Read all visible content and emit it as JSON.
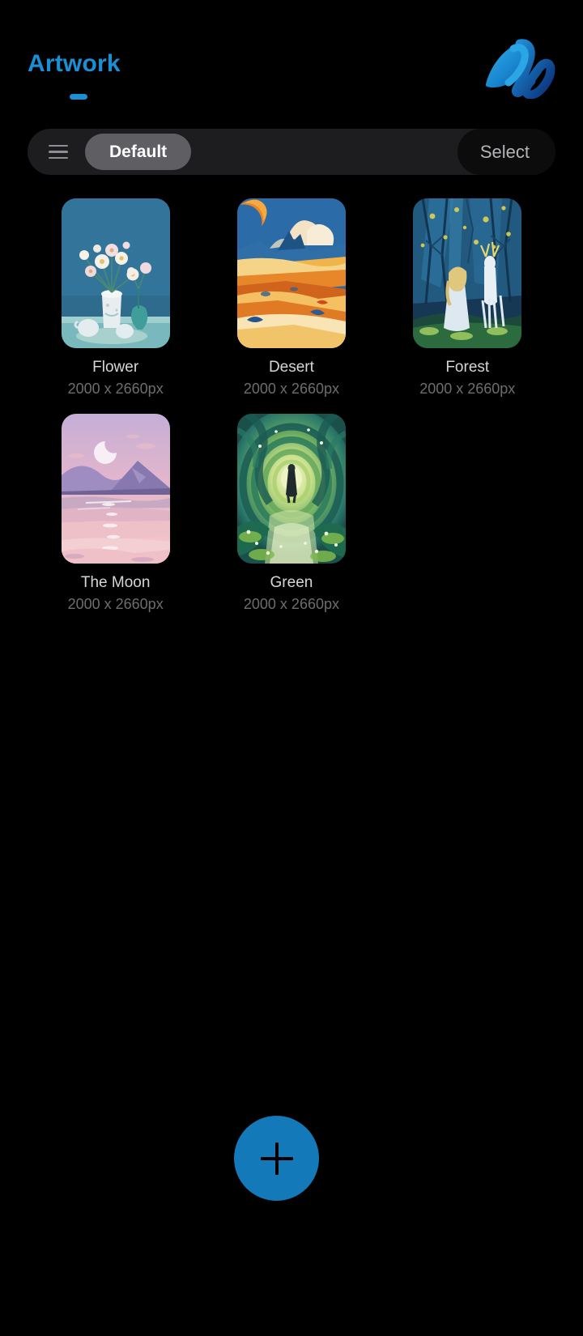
{
  "header": {
    "title": "Artwork",
    "title_color": "#1a8fd4",
    "logo_name": "brand-m-logo",
    "logo_colors": [
      "#29a3e0",
      "#1273c4",
      "#0b3f8f"
    ]
  },
  "toolbar": {
    "menu_icon": "hamburger-menu-icon",
    "preset_label": "Default",
    "select_label": "Select",
    "background": "#1d1d1f",
    "preset_background": "#5e5e63",
    "select_background": "#0c0c0d"
  },
  "gallery": {
    "items": [
      {
        "title": "Flower",
        "dimensions": "2000 x 2660px",
        "thumb_name": "artwork-thumb-flower",
        "palette": [
          "#3a7fa0",
          "#2d6a8c",
          "#e9eef0",
          "#f0c9cf",
          "#6fb2ad"
        ]
      },
      {
        "title": "Desert",
        "dimensions": "2000 x 2660px",
        "thumb_name": "artwork-thumb-desert",
        "palette": [
          "#2f6fa8",
          "#e8862a",
          "#f3c271",
          "#f7e3bd",
          "#d8541c"
        ]
      },
      {
        "title": "Forest",
        "dimensions": "2000 x 2660px",
        "thumb_name": "artwork-thumb-forest",
        "palette": [
          "#16334f",
          "#2b5f85",
          "#d9e6ef",
          "#e2d34c",
          "#8fbf5a"
        ]
      },
      {
        "title": "The Moon",
        "dimensions": "2000 x 2660px",
        "thumb_name": "artwork-thumb-the-moon",
        "palette": [
          "#c8aed6",
          "#f0b8c6",
          "#efc3ce",
          "#8c7fae",
          "#f7e9ef"
        ]
      },
      {
        "title": "Green",
        "dimensions": "2000 x 2660px",
        "thumb_name": "artwork-thumb-green",
        "palette": [
          "#1c6f6a",
          "#3f9a56",
          "#9ed06a",
          "#e8f2b0",
          "#14403f"
        ]
      }
    ]
  },
  "fab": {
    "icon": "plus-icon",
    "label": "",
    "background": "#1479b8"
  }
}
